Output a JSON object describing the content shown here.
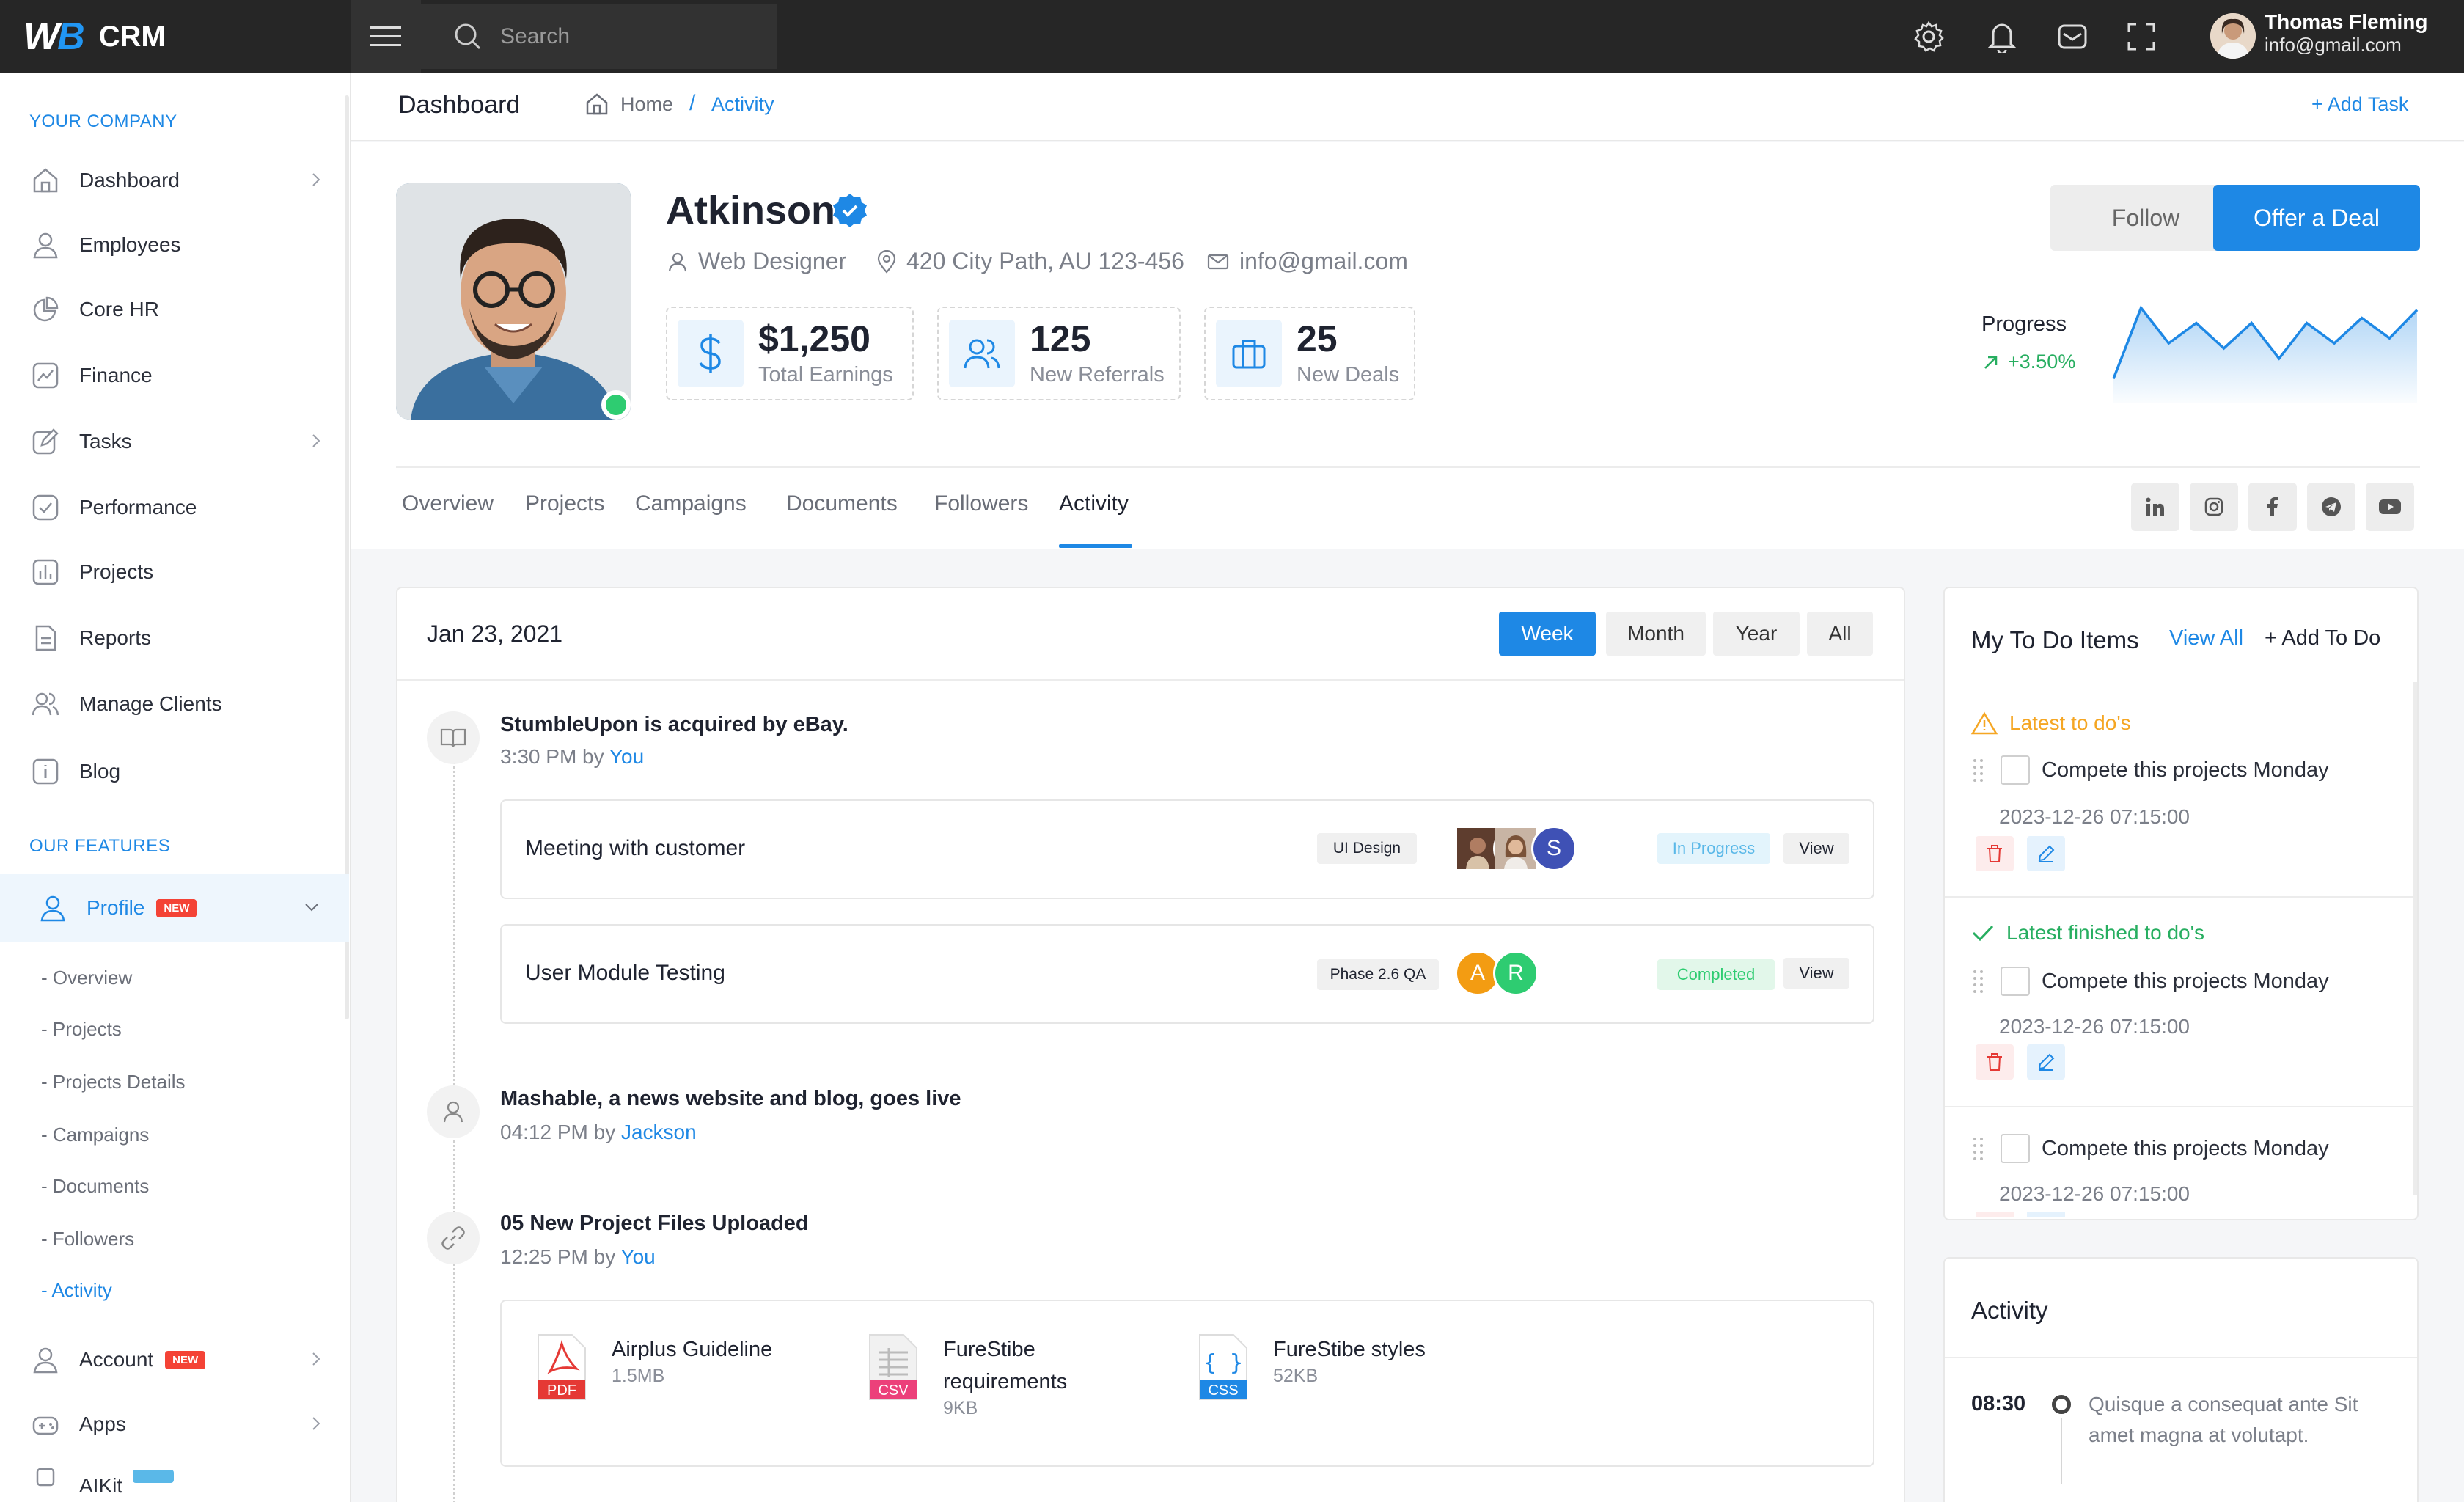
{
  "brand": {
    "logo": "WB",
    "name": "CRM"
  },
  "search": {
    "placeholder": "Search"
  },
  "user": {
    "name": "Thomas Fleming",
    "email": "info@gmail.com"
  },
  "sidebar": {
    "section_company": "YOUR COMPANY",
    "items": [
      {
        "label": "Dashboard",
        "icon": "home-icon"
      },
      {
        "label": "Employees",
        "icon": "user-icon"
      },
      {
        "label": "Core HR",
        "icon": "pie-chart-icon"
      },
      {
        "label": "Finance",
        "icon": "trend-icon"
      },
      {
        "label": "Tasks",
        "icon": "edit-icon"
      },
      {
        "label": "Performance",
        "icon": "check-square-icon"
      },
      {
        "label": "Projects",
        "icon": "bar-chart-icon"
      },
      {
        "label": "Reports",
        "icon": "file-icon"
      },
      {
        "label": "Manage Clients",
        "icon": "users-icon"
      },
      {
        "label": "Blog",
        "icon": "info-icon"
      }
    ],
    "section_features": "OUR FEATURES",
    "profile": {
      "label": "Profile",
      "badge": "NEW"
    },
    "sub_items": [
      "- Overview",
      "- Projects",
      "- Projects Details",
      "- Campaigns",
      "- Documents",
      "- Followers",
      "- Activity"
    ],
    "account": {
      "label": "Account",
      "badge": "NEW"
    },
    "apps": {
      "label": "Apps"
    },
    "aikit": {
      "label": "AIKit"
    }
  },
  "header": {
    "title": "Dashboard",
    "breadcrumb_home": "Home",
    "breadcrumb_sep": "/",
    "breadcrumb_current": "Activity",
    "add_task": "+ Add Task"
  },
  "profile": {
    "name": "Atkinson",
    "role": "Web Designer",
    "address": "420 City Path, AU 123-456",
    "email": "info@gmail.com",
    "stats": [
      {
        "value": "$1,250",
        "label": "Total Earnings",
        "icon": "dollar-icon"
      },
      {
        "value": "125",
        "label": "New Referrals",
        "icon": "users-icon"
      },
      {
        "value": "25",
        "label": "New Deals",
        "icon": "briefcase-icon"
      }
    ],
    "follow_label": "Follow",
    "deal_label": "Offer a Deal",
    "progress_label": "Progress",
    "progress_value": "+3.50%",
    "sparkline": [
      2,
      9,
      5.5,
      7.5,
      5,
      7.5,
      4,
      7.5,
      5.5,
      8,
      6,
      8.8
    ]
  },
  "tabs": [
    "Overview",
    "Projects",
    "Campaigns",
    "Documents",
    "Followers",
    "Activity"
  ],
  "active_tab": "Activity",
  "social": [
    "linkedin-icon",
    "instagram-icon",
    "facebook-icon",
    "telegram-icon",
    "youtube-icon"
  ],
  "timeline": {
    "date": "Jan 23, 2021",
    "filters": [
      "Week",
      "Month",
      "Year",
      "All"
    ],
    "active_filter": "Week",
    "events": [
      {
        "title": "StumbleUpon is acquired by eBay.",
        "time": "3:30 PM by",
        "who": "You",
        "icon": "book-icon"
      },
      {
        "title": "Mashable, a news website and blog, goes live",
        "time": "04:12 PM by",
        "who": "Jackson",
        "icon": "user-icon"
      },
      {
        "title": "05 New Project Files Uploaded",
        "time": "12:25 PM by",
        "who": "You",
        "icon": "link-icon"
      }
    ],
    "tasks": [
      {
        "name": "Meeting with customer",
        "tag": "UI Design",
        "status": "In Progress",
        "status_color": "#5ab8e8",
        "view": "View",
        "avatars": [
          "",
          "",
          "S"
        ]
      },
      {
        "name": "User Module Testing",
        "tag": "Phase 2.6 QA",
        "status": "Completed",
        "status_color": "#2ecc71",
        "view": "View",
        "avatars": [
          "A",
          "R"
        ]
      }
    ],
    "files": [
      {
        "name": "Airplus Guideline",
        "size": "1.5MB",
        "type": "PDF",
        "color": "#e53935"
      },
      {
        "name": "FureStibe requirements",
        "name_line1": "FureStibe",
        "name_line2": "requirements",
        "size": "9KB",
        "type": "CSV",
        "color": "#ec407a"
      },
      {
        "name": "FureStibe styles",
        "size": "52KB",
        "type": "CSS",
        "color": "#1e88e5"
      }
    ]
  },
  "todo": {
    "title": "My To Do Items",
    "view_all": "View All",
    "add": "+ Add To Do",
    "latest_label": "Latest to do's",
    "finished_label": "Latest finished to do's",
    "items": [
      {
        "text": "Compete this projects Monday",
        "time": "2023-12-26 07:15:00"
      },
      {
        "text": "Compete this projects Monday",
        "time": "2023-12-26 07:15:00"
      },
      {
        "text": "Compete this projects Monday",
        "time": "2023-12-26 07:15:00"
      }
    ]
  },
  "activity_side": {
    "title": "Activity",
    "time": "08:30",
    "text": "Quisque a consequat ante Sit amet magna at volutapt."
  },
  "colors": {
    "accent": "#1e88e5",
    "success": "#27ae60",
    "warning": "#f5a623",
    "danger": "#e53935",
    "topbar": "#262626"
  }
}
